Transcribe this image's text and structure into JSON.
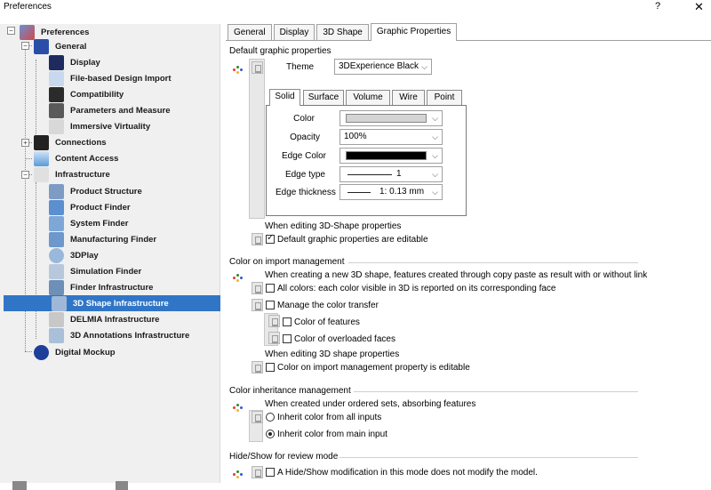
{
  "window": {
    "title": "Preferences",
    "help": "?",
    "close": "✕"
  },
  "tree": {
    "items": [
      {
        "label": "Preferences",
        "icon": "preferences-icon"
      },
      {
        "label": "General",
        "icon": "general-icon"
      },
      {
        "label": "Display",
        "icon": "display-icon"
      },
      {
        "label": "File-based Design Import",
        "icon": "file-import-icon"
      },
      {
        "label": "Compatibility",
        "icon": "compatibility-icon"
      },
      {
        "label": "Parameters and Measure",
        "icon": "parameters-icon"
      },
      {
        "label": "Immersive Virtuality",
        "icon": "virtuality-icon"
      },
      {
        "label": "Connections",
        "icon": "connections-icon"
      },
      {
        "label": "Content Access",
        "icon": "content-access-icon"
      },
      {
        "label": "Infrastructure",
        "icon": "infrastructure-icon"
      },
      {
        "label": "Product Structure",
        "icon": "product-structure-icon"
      },
      {
        "label": "Product Finder",
        "icon": "product-finder-icon"
      },
      {
        "label": "System Finder",
        "icon": "system-finder-icon"
      },
      {
        "label": "Manufacturing Finder",
        "icon": "manufacturing-finder-icon"
      },
      {
        "label": "3DPlay",
        "icon": "3dplay-icon"
      },
      {
        "label": "Simulation Finder",
        "icon": "simulation-finder-icon"
      },
      {
        "label": "Finder Infrastructure",
        "icon": "finder-infrastructure-icon"
      },
      {
        "label": "3D Shape Infrastructure",
        "icon": "3d-shape-icon"
      },
      {
        "label": "DELMIA Infrastructure",
        "icon": "delmia-icon"
      },
      {
        "label": "3D Annotations Infrastructure",
        "icon": "annotations-icon"
      },
      {
        "label": "Digital Mockup",
        "icon": "digital-mockup-icon"
      }
    ]
  },
  "tabs": [
    {
      "label": "General"
    },
    {
      "label": "Display"
    },
    {
      "label": "3D Shape"
    },
    {
      "label": "Graphic Properties"
    }
  ],
  "default_graphic": {
    "title": "Default graphic properties",
    "theme_label": "Theme",
    "theme_value": "3DExperience Black",
    "subtabs": [
      "Solid",
      "Surface",
      "Volume",
      "Wire",
      "Point"
    ],
    "color_label": "Color",
    "color_value": "",
    "opacity_label": "Opacity",
    "opacity_value": "100%",
    "edge_color_label": "Edge Color",
    "edge_type_label": "Edge type",
    "edge_type_value": "1",
    "edge_thickness_label": "Edge thickness",
    "edge_thickness_value": "1: 0.13 mm",
    "editing_title": "When editing 3D-Shape properties",
    "editable_label": "Default graphic properties are editable",
    "editable_checked": true
  },
  "color_import": {
    "title": "Color on import management",
    "creating_text": "When creating a new 3D shape, features created through copy paste as result with or without link",
    "all_colors_label": "All colors: each color visible in 3D is reported on its corresponding face",
    "manage_transfer_label": "Manage the color transfer",
    "color_features_label": "Color of features",
    "color_overloaded_label": "Color of overloaded faces",
    "editing_title": "When editing 3D shape properties",
    "editable_label": "Color on import management property is editable"
  },
  "color_inheritance": {
    "title": "Color inheritance management",
    "ordered_text": "When created under ordered sets, absorbing features",
    "inherit_all_label": "Inherit color from all inputs",
    "inherit_main_label": "Inherit color from main input",
    "selected": "main"
  },
  "hide_show": {
    "title": "Hide/Show for review mode",
    "label": "A Hide/Show modification in this mode does not modify the model."
  },
  "colors": {
    "selection": "#3176c6",
    "edge_color": "#000000",
    "color_swatch": "#d4d4d4"
  }
}
